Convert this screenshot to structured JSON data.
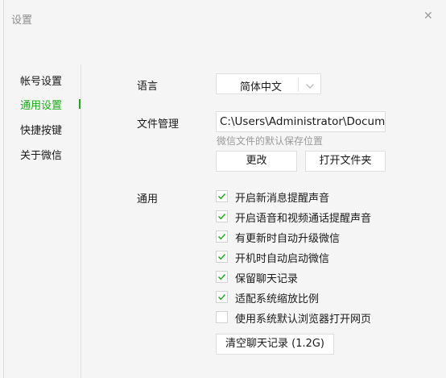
{
  "window": {
    "title": "设置"
  },
  "nav": {
    "items": [
      {
        "label": "帐号设置",
        "active": false
      },
      {
        "label": "通用设置",
        "active": true
      },
      {
        "label": "快捷按键",
        "active": false
      },
      {
        "label": "关于微信",
        "active": false
      }
    ]
  },
  "general": {
    "language_label": "语言",
    "language_value": "简体中文",
    "file_label": "文件管理",
    "file_path": "C:\\Users\\Administrator\\Documents\\WeChat Files",
    "file_hint": "微信文件的默认保存位置",
    "change_button": "更改",
    "open_folder_button": "打开文件夹",
    "common_label": "通用",
    "options": [
      {
        "label": "开启新消息提醒声音",
        "checked": true
      },
      {
        "label": "开启语音和视频通话提醒声音",
        "checked": true
      },
      {
        "label": "有更新时自动升级微信",
        "checked": true
      },
      {
        "label": "开机时自动启动微信",
        "checked": true
      },
      {
        "label": "保留聊天记录",
        "checked": true
      },
      {
        "label": "适配系统缩放比例",
        "checked": true
      },
      {
        "label": "使用系统默认浏览器打开网页",
        "checked": false
      }
    ],
    "clear_button": "清空聊天记录 (1.2G)"
  },
  "colors": {
    "accent": "#1aad19",
    "background": "#f5f5f5"
  },
  "icons": {
    "close": "close-icon",
    "dropdown": "chevron-down-icon",
    "check": "check-icon"
  }
}
